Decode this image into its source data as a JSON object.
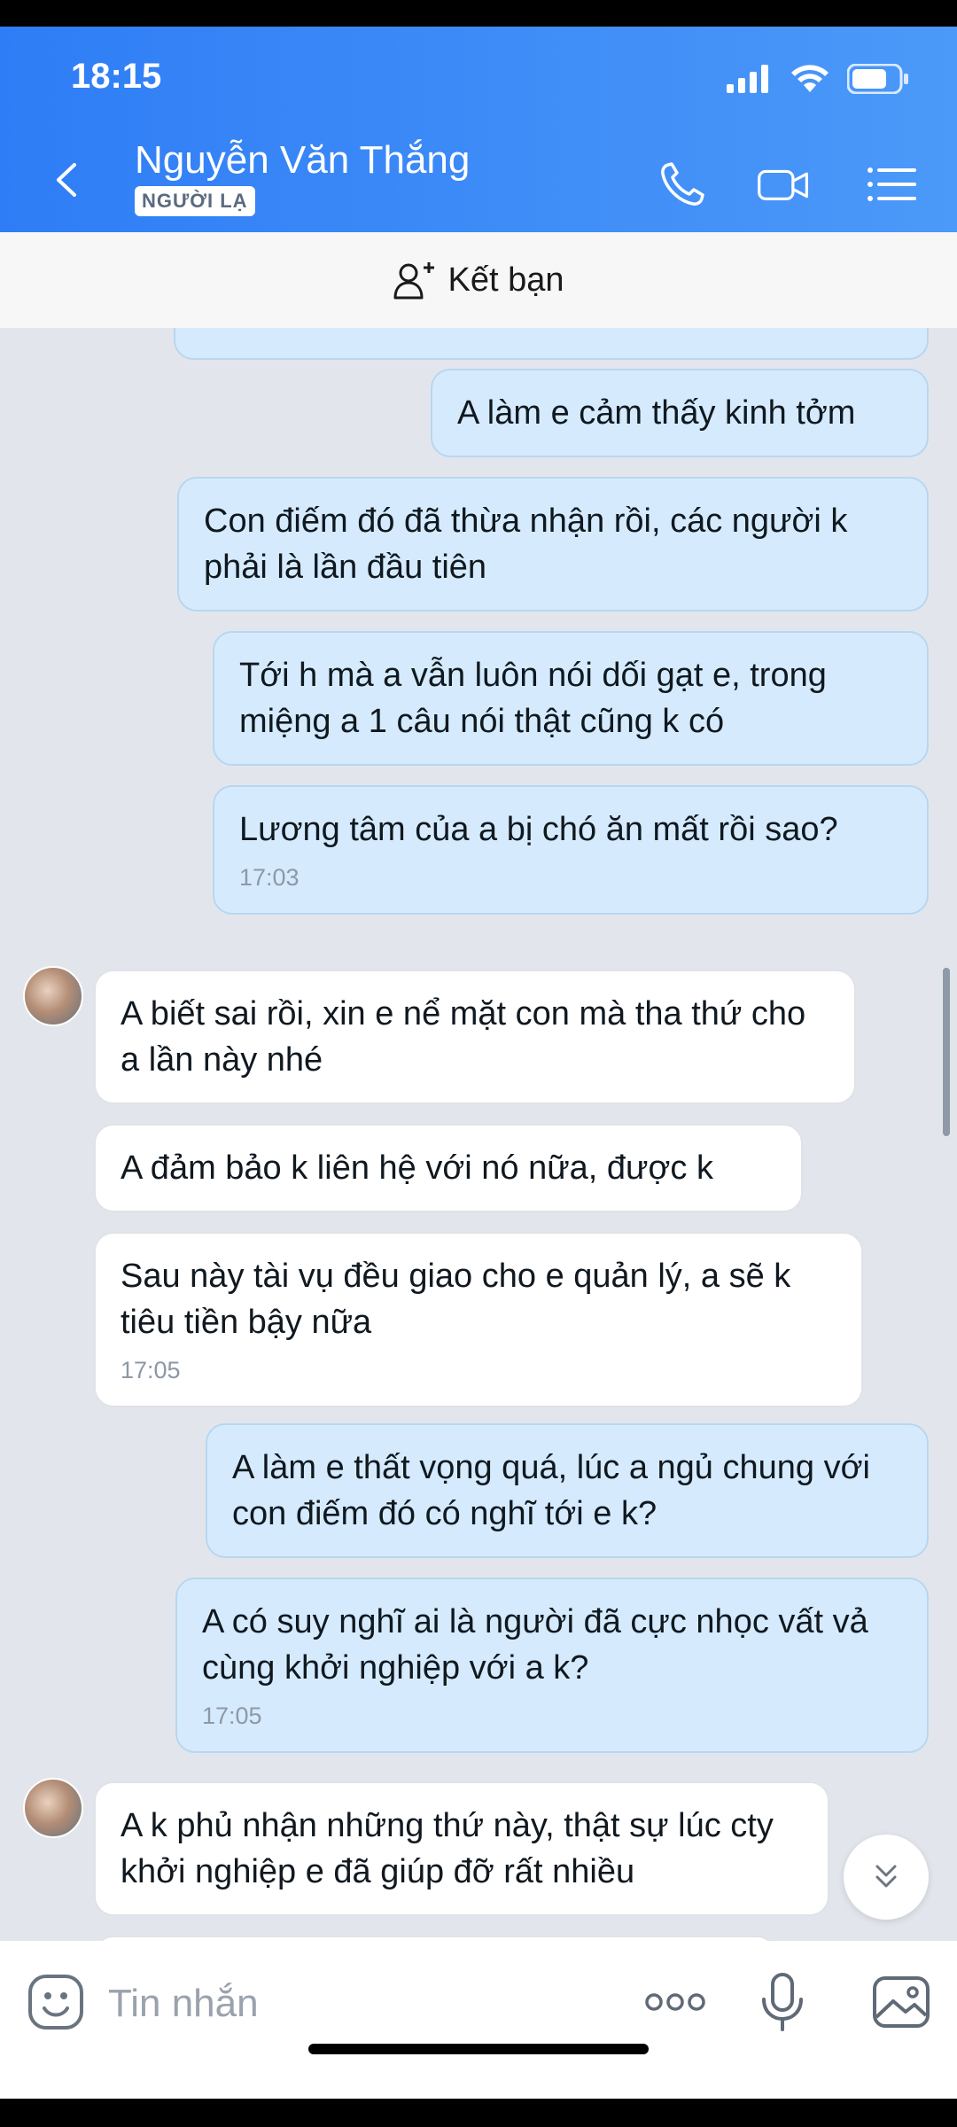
{
  "status_bar": {
    "time": "18:15"
  },
  "header": {
    "contact_name": "Nguyễn Văn Thắng",
    "badge": "NGƯỜI LẠ",
    "icons": [
      "chevron-left-icon",
      "phone-icon",
      "video-icon",
      "menu-list-icon"
    ]
  },
  "friend_bar": {
    "label": "Kết bạn",
    "icon": "add-user-icon"
  },
  "messages": [
    {
      "sender": "me",
      "text": "A làm e cảm thấy kinh tởm"
    },
    {
      "sender": "me",
      "text": "Con điếm đó đã thừa nhận rồi, các người k phải là lần đầu tiên"
    },
    {
      "sender": "me",
      "text": "Tới h mà a vẫn luôn nói dối gạt e, trong miệng a 1 câu nói thật cũng k có"
    },
    {
      "sender": "me",
      "text": "Lương tâm của a bị chó ăn mất rồi sao?",
      "time": "17:03"
    },
    {
      "sender": "them",
      "text": "A biết sai rồi, xin e nể mặt con mà tha thứ cho a lần này nhé"
    },
    {
      "sender": "them",
      "text": "A đảm bảo k liên hệ với nó nữa, được k"
    },
    {
      "sender": "them",
      "text": "Sau này tài vụ đều giao cho e quản lý, a sẽ k tiêu tiền bậy nữa",
      "time": "17:05"
    },
    {
      "sender": "me",
      "text": "A làm e thất vọng quá, lúc a ngủ chung với con điếm đó có nghĩ tới e k?"
    },
    {
      "sender": "me",
      "text": "A có suy nghĩ ai là người đã cực nhọc vất vả cùng khởi nghiệp với a k?",
      "time": "17:05"
    },
    {
      "sender": "them",
      "text": "A k phủ nhận những thứ này, thật sự lúc cty khởi nghiệp e đã giúp đỡ rất nhiều"
    }
  ],
  "input": {
    "placeholder": "Tin nhắn"
  },
  "colors": {
    "header": "#2f7df6",
    "my_bubble": "#d5ebfd",
    "their_bubble": "#ffffff",
    "chat_bg": "#e2e6ec"
  }
}
